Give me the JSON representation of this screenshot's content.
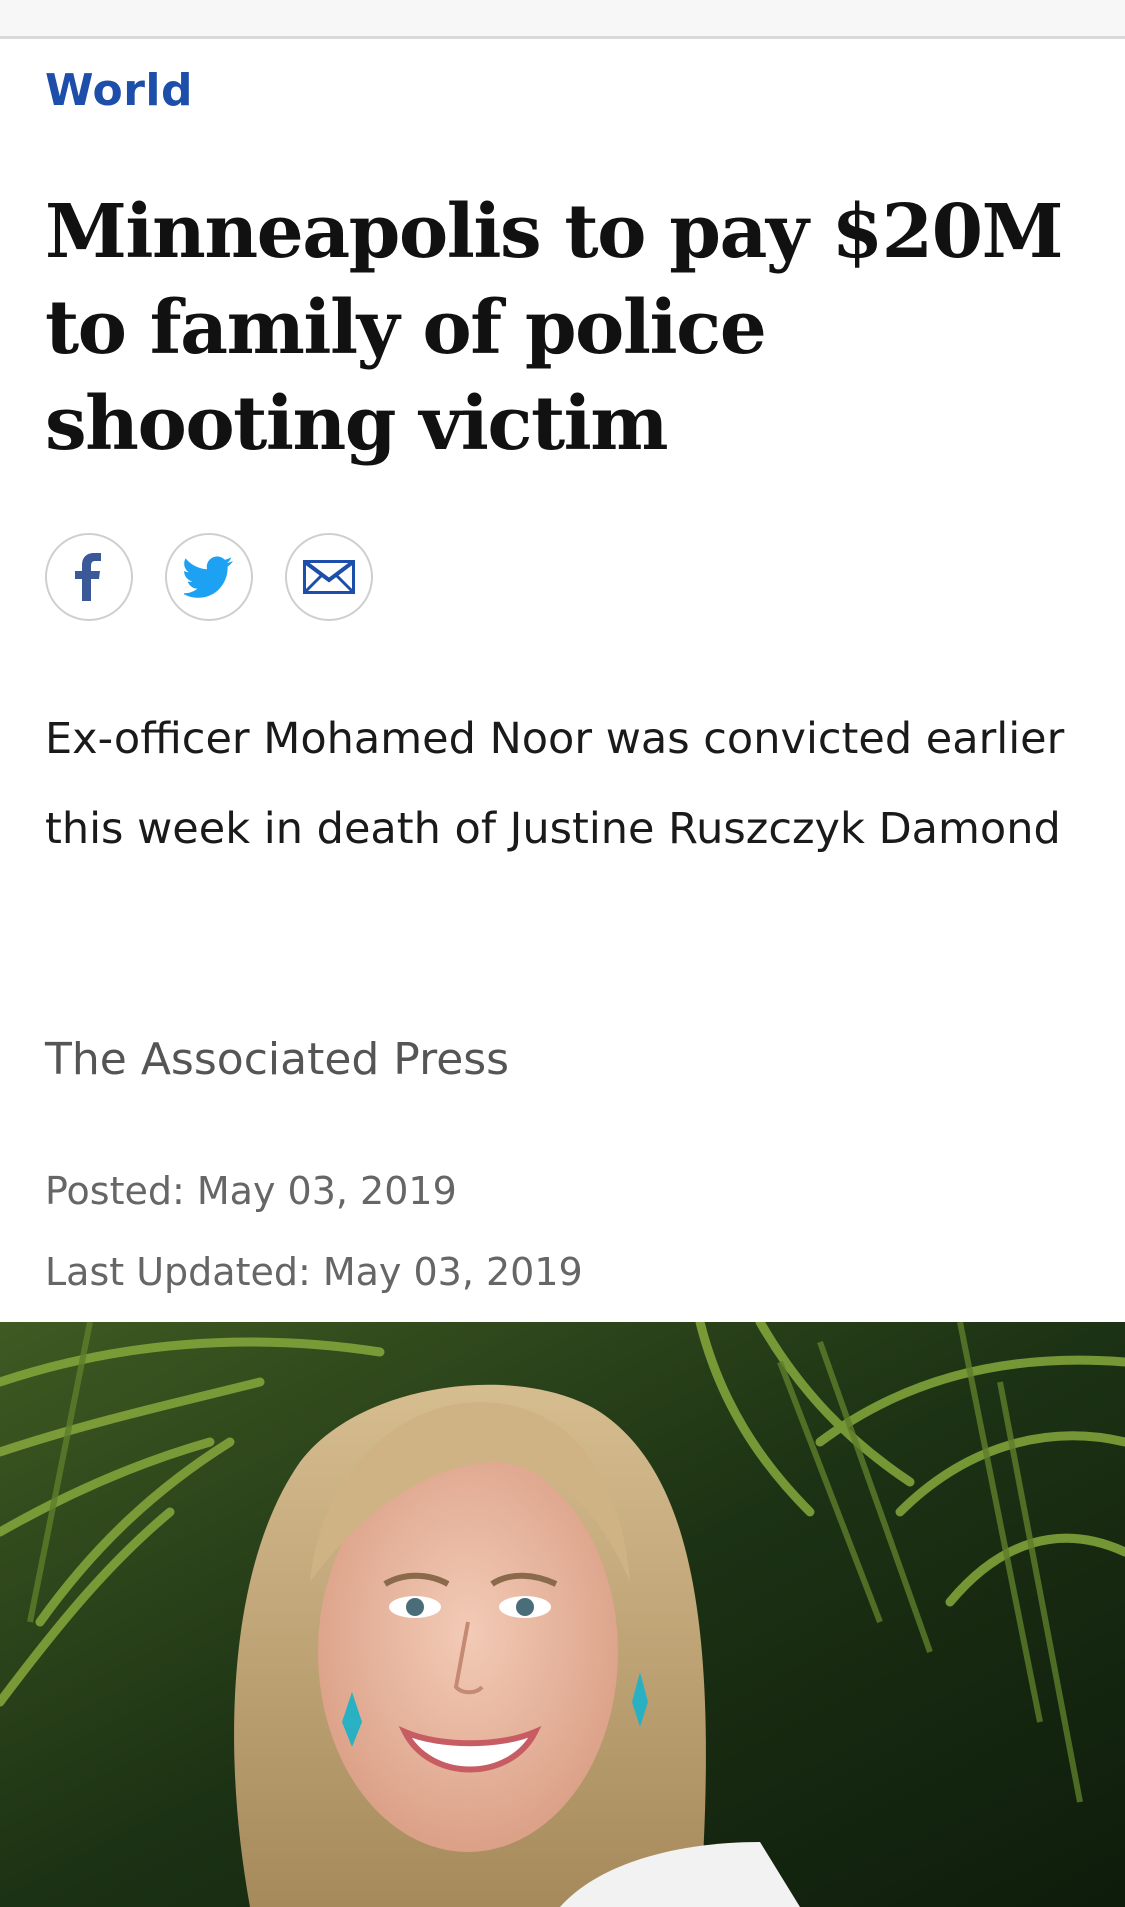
{
  "section": {
    "label": "World"
  },
  "article": {
    "headline": "Minneapolis to pay $20M to family of police shooting victim",
    "dek": "Ex-officer Mohamed Noor was convicted earlier this week in death of Justine Ruszczyk Damond",
    "byline": "The Associated Press",
    "posted": "Posted: May 03, 2019",
    "updated": "Last Updated: May 03, 2019"
  },
  "share": {
    "buttons": [
      {
        "icon": "facebook-icon",
        "color": "#3b5998"
      },
      {
        "icon": "twitter-icon",
        "color": "#1da1f2"
      },
      {
        "icon": "email-icon",
        "color": "#1d4ea9"
      }
    ]
  },
  "colors": {
    "section_link": "#1d4ea9",
    "headline": "#111111",
    "meta_text": "#666666"
  },
  "hero_image": {
    "subject": "photo-of-woman-smiling-in-front-of-palm-leaves"
  }
}
